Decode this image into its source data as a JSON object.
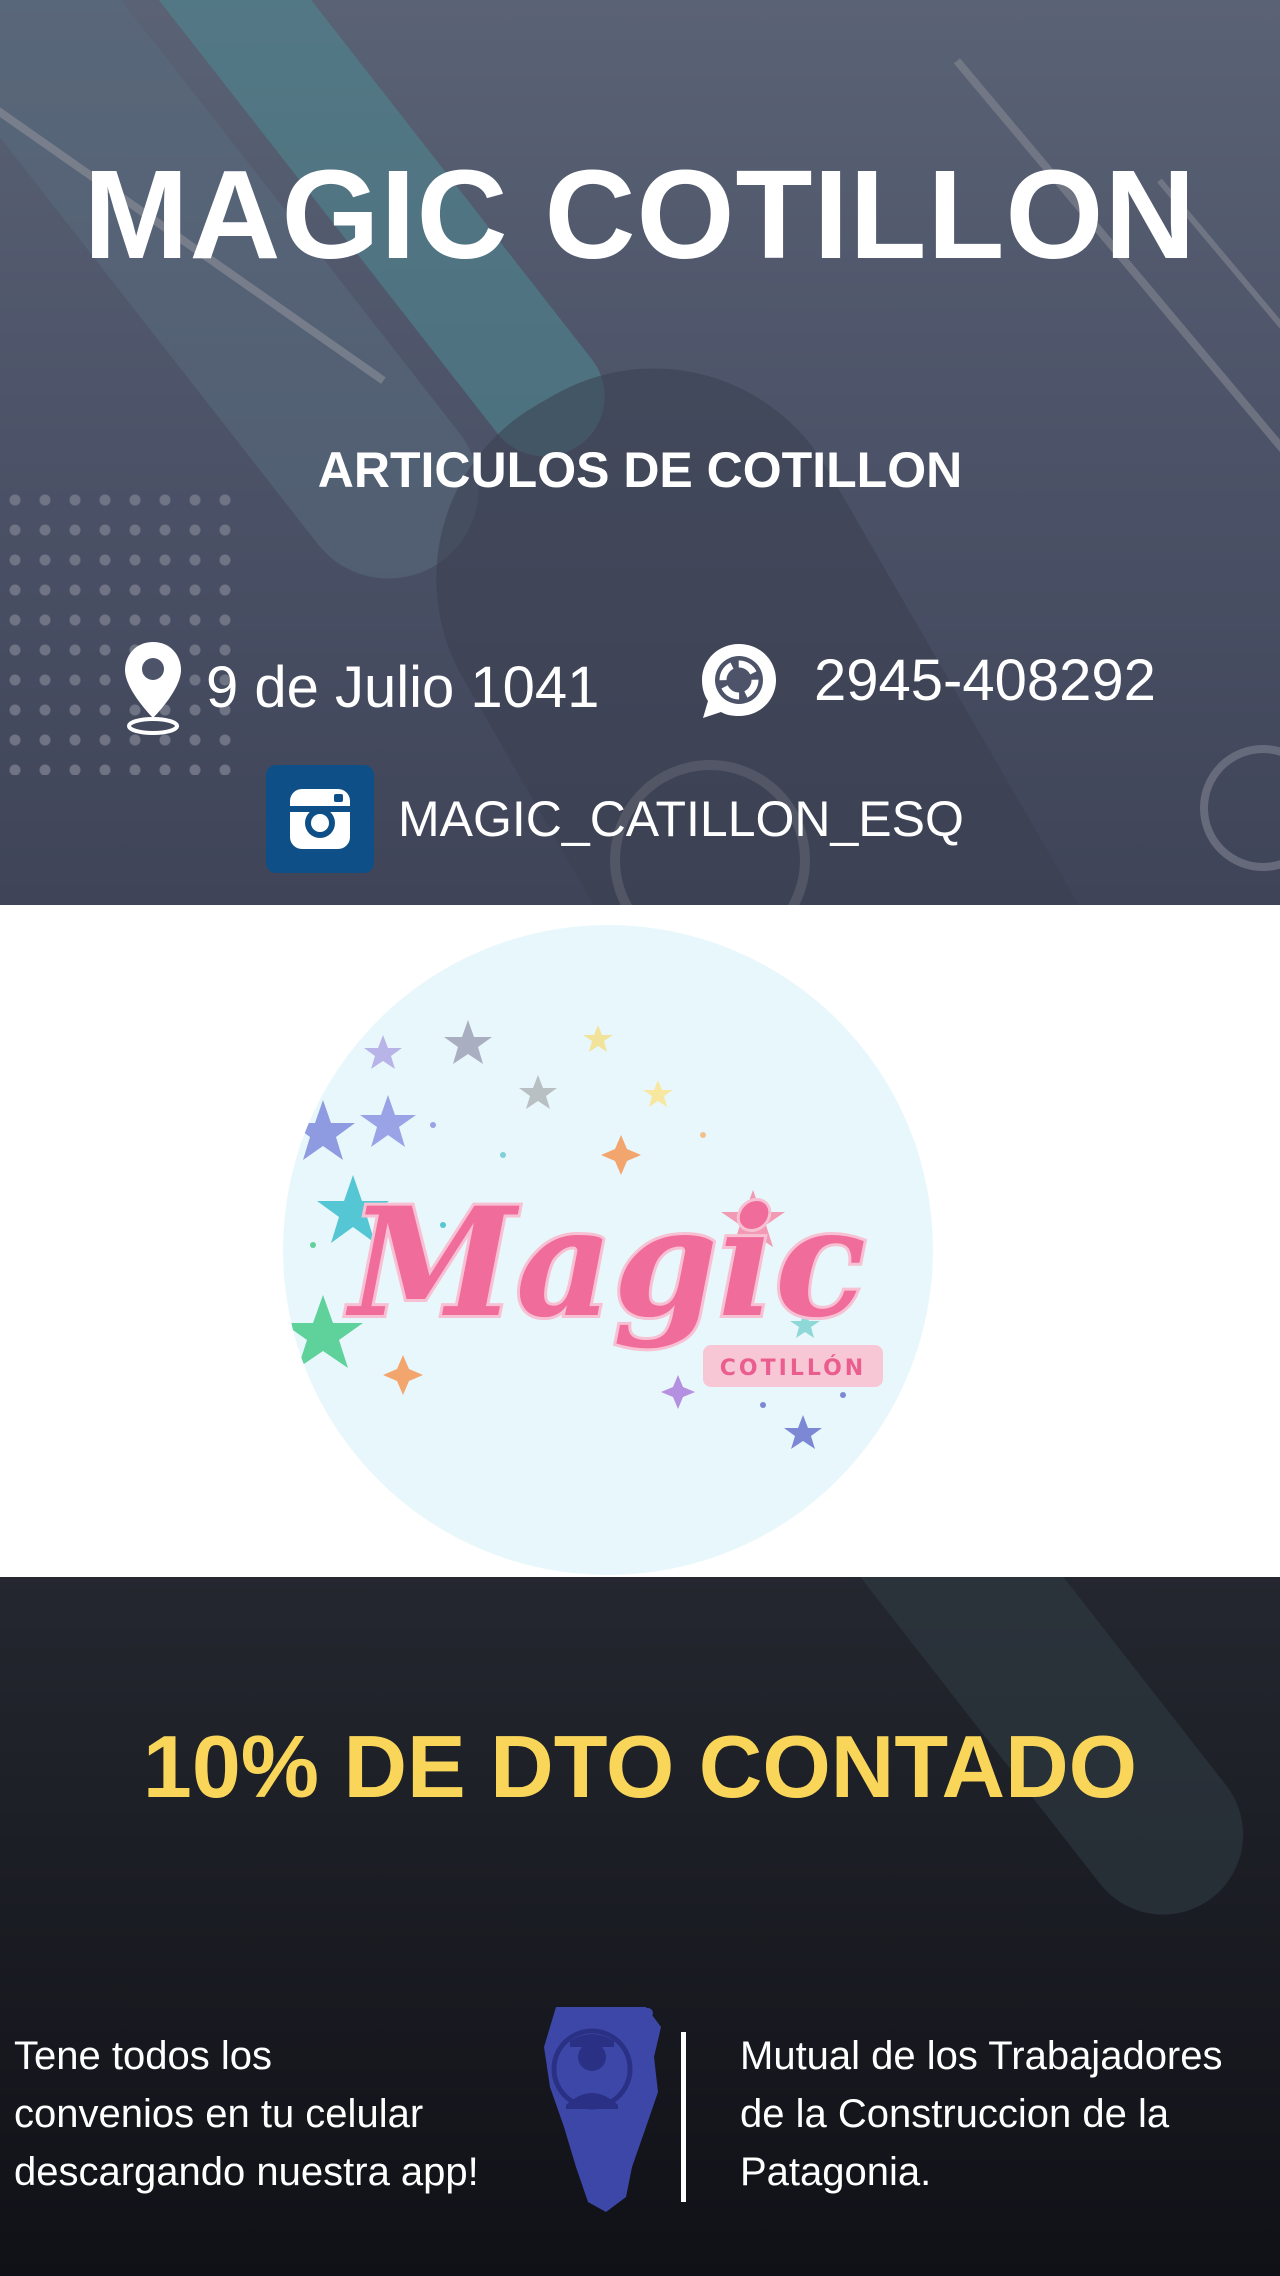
{
  "header": {
    "title": "MAGIC COTILLON",
    "subtitle": "ARTICULOS DE COTILLON",
    "address": "9 de Julio 1041",
    "phone": "2945-408292",
    "instagram": "MAGIC_CATILLON_ESQ",
    "icons": [
      "location-pin-icon",
      "whatsapp-icon",
      "instagram-icon"
    ]
  },
  "logo": {
    "main_text": "Magic",
    "badge_text": "COTILLÓN"
  },
  "promo": {
    "text": "10% DE DTO CONTADO",
    "color": "#f9d65a"
  },
  "footer": {
    "left_lines": [
      "Tene todos los",
      "convenios en tu celular",
      "descargando nuestra app!"
    ],
    "right_lines": [
      "Mutual de los Trabajadores",
      "de la Construccion de la",
      "Patagonia."
    ]
  },
  "colors": {
    "header_bg": "#4d5469",
    "instagram_bg": "#0f4f87",
    "logo_bg": "#e8f7fc",
    "logo_text": "#f06c9b",
    "bottom_bg": "#1c1e25"
  }
}
